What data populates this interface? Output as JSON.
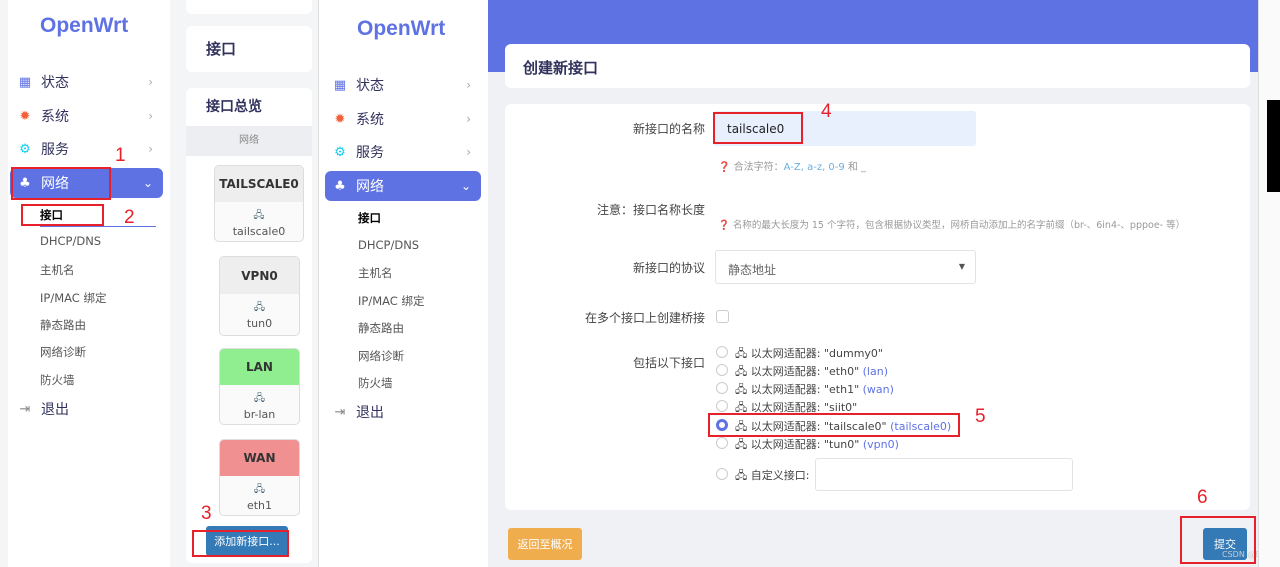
{
  "brand": "OpenWrt",
  "nav": [
    {
      "label": "状态",
      "icon": "dashboard-icon"
    },
    {
      "label": "系统",
      "icon": "gear-icon"
    },
    {
      "label": "服务",
      "icon": "services-icon"
    },
    {
      "label": "网络",
      "icon": "network-icon"
    }
  ],
  "network_sub": [
    "接口",
    "DHCP/DNS",
    "主机名",
    "IP/MAC 绑定",
    "静态路由",
    "网络诊断",
    "防火墙"
  ],
  "logout": "退出",
  "overview": {
    "page_title": "接口",
    "section_title": "接口总览",
    "column_header": "网络",
    "interfaces": [
      {
        "name": "TAILSCALE0",
        "device": "tailscale0",
        "color": "#eeeeee"
      },
      {
        "name": "VPN0",
        "device": "tun0",
        "color": "#eeeeee"
      },
      {
        "name": "LAN",
        "device": "br-lan",
        "color": "#90ee90"
      },
      {
        "name": "WAN",
        "device": "eth1",
        "color": "#f09090"
      }
    ],
    "add_button": "添加新接口..."
  },
  "dialog": {
    "title": "创建新接口",
    "name_label": "新接口的名称",
    "name_value": "tailscale0",
    "name_hint": "合法字符：",
    "name_hint_chars": "A-Z, a-z, 0-9",
    "name_hint_and": "和 _",
    "note_label": "注意：接口名称长度",
    "note_hint": "名称的最大长度为 15 个字符，包含根据协议类型，网桥自动添加上的名字前缀（br-、6in4-、pppoe- 等）",
    "protocol_label": "新接口的协议",
    "protocol_value": "静态地址",
    "bridge_label": "在多个接口上创建桥接",
    "include_label": "包括以下接口",
    "options": [
      {
        "text": "以太网适配器: \"dummy0\"",
        "net": ""
      },
      {
        "text": "以太网适配器: \"eth0\"",
        "net": "(lan)"
      },
      {
        "text": "以太网适配器: \"eth1\"",
        "net": "(wan)"
      },
      {
        "text": "以太网适配器: \"siit0\"",
        "net": ""
      },
      {
        "text": "以太网适配器: \"tailscale0\"",
        "net": "(tailscale0)"
      },
      {
        "text": "以太网适配器: \"tun0\"",
        "net": "(vpn0)"
      }
    ],
    "custom_label": "自定义接口:",
    "back_button": "返回至概况",
    "submit_button": "提交"
  },
  "annotations": [
    "1",
    "2",
    "3",
    "4",
    "5",
    "6"
  ],
  "watermark": "CSDN @Bldjo",
  "colors": {
    "accent": "#5e72e4",
    "annotation": "#e8202a",
    "back": "#f0ad4e",
    "submit": "#337ab7"
  }
}
